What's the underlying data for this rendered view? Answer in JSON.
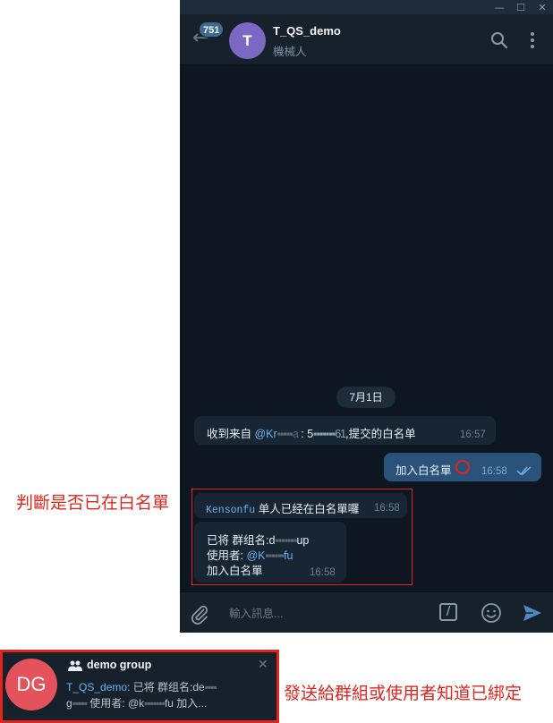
{
  "window": {
    "controls": {
      "minimize": "—",
      "maximize": "☐",
      "close": "✕"
    }
  },
  "header": {
    "back_icon": "←",
    "unread_count": "751",
    "avatar_letter": "T",
    "title": "T_QS_demo",
    "subtitle": "機械人",
    "avatar_color": "#7b68c4"
  },
  "chat": {
    "date_separator": "7月1日",
    "messages": [
      {
        "direction": "in",
        "prefix": "收到来自 ",
        "mention": "@Kr",
        "mention_blur": "▪▪▪▪▪a",
        "mid": " : 5",
        "id_blur": "▪▪▪▪▪▪▪61",
        "suffix": ",提交的白名单",
        "time": "16:57"
      },
      {
        "direction": "out",
        "text": "加入白名單",
        "time": "16:58",
        "status_icon": "double-check-icon"
      },
      {
        "direction": "in",
        "name": "Kensonfu",
        "text": " 单人已经在白名單囉",
        "time": "16:58"
      },
      {
        "direction": "in",
        "line1_prefix": "已将 群组名:d",
        "line1_blur": "▪▪▪▪▪▪▪",
        "line1_suffix": "up",
        "line2_prefix": "使用者: ",
        "line2_mention": "@K",
        "line2_blur": "▪▪▪▪▪▪",
        "line2_mention_end": "fu",
        "line3": "加入白名單",
        "time": "16:58"
      }
    ]
  },
  "composer": {
    "placeholder": "輸入訊息...",
    "command_label": "/"
  },
  "annotations": {
    "left_label": "判斷是否已在白名單",
    "bottom_label": "發送給群組或使用者知道已綁定",
    "color": "#e0251e"
  },
  "notification": {
    "avatar_initials": "DG",
    "avatar_color": "#e4525c",
    "group_name": "demo group",
    "close_icon": "✕",
    "sender": "T_QS_demo",
    "line1_text": ": 已将 群组名:de",
    "line1_blur": "▪▪▪▪",
    "line2_prefix": "g",
    "line2_blur": "▪▪▪▪▪",
    "line2_mid": " 使用者: @k",
    "line2_blur2": "▪▪▪▪▪▪▪",
    "line2_suffix": "fu  加入..."
  }
}
